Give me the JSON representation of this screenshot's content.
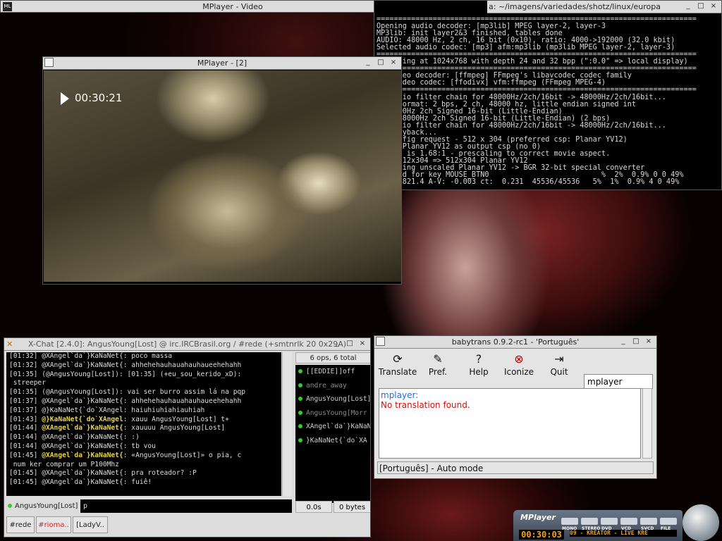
{
  "mplayer_video": {
    "title": "MPlayer - Video",
    "logo": "ML"
  },
  "terminal": {
    "title": "a: ~/imagens/variedades/shotz/linux/europa",
    "lines": [
      "==========================================================================",
      "Opening audio decoder: [mp3lib] MPEG layer-2, layer-3",
      "MP3lib: init layer2&3 finished, tables done",
      "AUDIO: 48000 Hz, 2 ch, 16 bit (0x10), ratio: 4000->192000 (32.0 kbit)",
      "Selected audio codec: [mp3] afm:mp3lib (mp3lib MPEG layer-2, layer-3)",
      "==========================================================================",
      "1 running at 1024x768 with depth 24 and 32 bpp (\":0.0\" => local display)",
      "==========================================================================",
      "ng video decoder: [ffmpeg] FFmpeg's libavcodec codec family",
      "ted video codec: [ffodivx] vfm:ffmpeg (FFmpeg MPEG-4)",
      "==========================================================================",
      "ng audio filter chain for 48000Hz/2ch/16bit -> 48000Hz/2ch/16bit...",
      ": af format: 2 bps, 2 ch, 48000 hz, little endian signed int",
      ": 48000Hz 2ch Signed 16-bit (Little-Endian)",
      "oss] 48000Hz 2ch Signed 16-bit (Little-Endian) (2 bps)",
      "ng audio filter chain for 48000Hz/2ch/16bit -> 48000Hz/2ch/16bit...",
      "ng playback...",
      "vo config request - 512 x 304 (preferred csp: Planar YV12)",
      "using Planar YV12 as output csp (no 0)",
      "Aspect is 1.68:1 - prescaling to correct movie aspect.",
      ":11] 512x304 => 512x304 Planar YV12",
      "er: using unscaled Planar YV12 -> BGR 32-bit special converter",
      "d found for key MOUSE_BTN0                          %  2%  0.9% 0 0 49%",
      ".4 V:1821.4 A-V: -0.003 ct:  0.231  45536/45536   5%  1%  0.9% 4 0 49%"
    ]
  },
  "mplayer2": {
    "title": "MPlayer - [2]",
    "osd_time": "00:30:21"
  },
  "xchat": {
    "title": "X-Chat [2.4.0]: AngusYoung[Lost] @ irc.IRCBrasil.org / #rede (+smtnrlk 20 0x29A)",
    "lines": [
      {
        "ts": "[01:32]",
        "nick": "@XAngel`da`}KaNaNet{",
        "hl": false,
        "msg": ": poco massa"
      },
      {
        "ts": "[01:32]",
        "nick": "@XAngel`da`}KaNaNet{",
        "hl": false,
        "msg": ": ahhehehauhauahauhaueehehahh"
      },
      {
        "ts": "[01:35]",
        "nick": "(@AngusYoung[Lost])",
        "hl": false,
        "msg": ": [01:35] (+eu_sou_kerido_xD):"
      },
      {
        "ts": "",
        "nick": "",
        "hl": false,
        "msg": " streeper"
      },
      {
        "ts": "[01:35]",
        "nick": "(@AngusYoung[Lost])",
        "hl": false,
        "msg": ": vai ser burro assim lá na pqp"
      },
      {
        "ts": "[01:37]",
        "nick": "@XAngel`da`}KaNaNet{",
        "hl": false,
        "msg": ": ahhehehauhauahauhaueehehahh"
      },
      {
        "ts": "[01:37]",
        "nick": "@}KaNaNet{`do`XAngel",
        "hl": false,
        "msg": ": haiuhiuhiahiauhiah"
      },
      {
        "ts": "[01:43]",
        "nick": "@}KaNaNet{`do`XAngel",
        "hl": true,
        "msg": ": xauu AngusYoung[Lost] t+"
      },
      {
        "ts": "[01:44]",
        "nick": "@XAngel`da`}KaNaNet{",
        "hl": true,
        "msg": ": xauuuu AngusYoung[Lost]"
      },
      {
        "ts": "[01:44]",
        "nick": "@XAngel`da`}KaNaNet{",
        "hl": false,
        "msg": ": :)"
      },
      {
        "ts": "[01:44]",
        "nick": "@XAngel`da`}KaNaNet{",
        "hl": false,
        "msg": ": tb vou"
      },
      {
        "ts": "[01:45]",
        "nick": "@XAngel`da`}KaNaNet{",
        "hl": true,
        "msg": ": «AngusYoung[Lost]» o pia, c"
      },
      {
        "ts": "",
        "nick": "",
        "hl": false,
        "msg": " num ker comprar um P100Mhz"
      },
      {
        "ts": "[01:45]",
        "nick": "@XAngel`da`}KaNaNet{",
        "hl": false,
        "msg": ": pra roteador? :P"
      },
      {
        "ts": "[01:45]",
        "nick": "@XAngel`da`}KaNaNet{",
        "hl": false,
        "msg": ": fuiê!"
      }
    ],
    "users_header": "6 ops, 6 total",
    "users": [
      {
        "name": "[[EDDIE]]off",
        "away": false
      },
      {
        "name": "andre_away",
        "away": true
      },
      {
        "name": "AngusYoung[Lost]",
        "away": false
      },
      {
        "name": "AngusYoung[Morr",
        "away": true
      },
      {
        "name": "XAngel`da`}KaNaN",
        "away": false
      },
      {
        "name": "}KaNaNet{`do`XA",
        "away": false
      }
    ],
    "lag": "0.0s",
    "throttle": "0 bytes",
    "nick": "AngusYoung[Lost]",
    "input_value": "p",
    "tabs": [
      {
        "label": "#rede",
        "hl": false
      },
      {
        "label": "#rioma..",
        "hl": true
      },
      {
        "label": "[LadyV..",
        "hl": false
      }
    ]
  },
  "babytrans": {
    "title": "babytrans 0.9.2-rc1 - 'Português'",
    "buttons": {
      "translate": "Translate",
      "pref": "Pref.",
      "help": "Help",
      "iconize": "Iconize",
      "quit": "Quit"
    },
    "search_value": "mplayer",
    "word": "mplayer:",
    "result": "No translation found.",
    "status": "[Português] - Auto mode"
  },
  "mplayer_skin": {
    "brand": "MPlayer",
    "button_labels": [
      "MONO",
      "STEREO",
      "DVD",
      "VCD",
      "SVCD",
      "FILE"
    ],
    "time": "00:30:03",
    "scroller": "09 - KREATOR - LIVE KRE"
  }
}
